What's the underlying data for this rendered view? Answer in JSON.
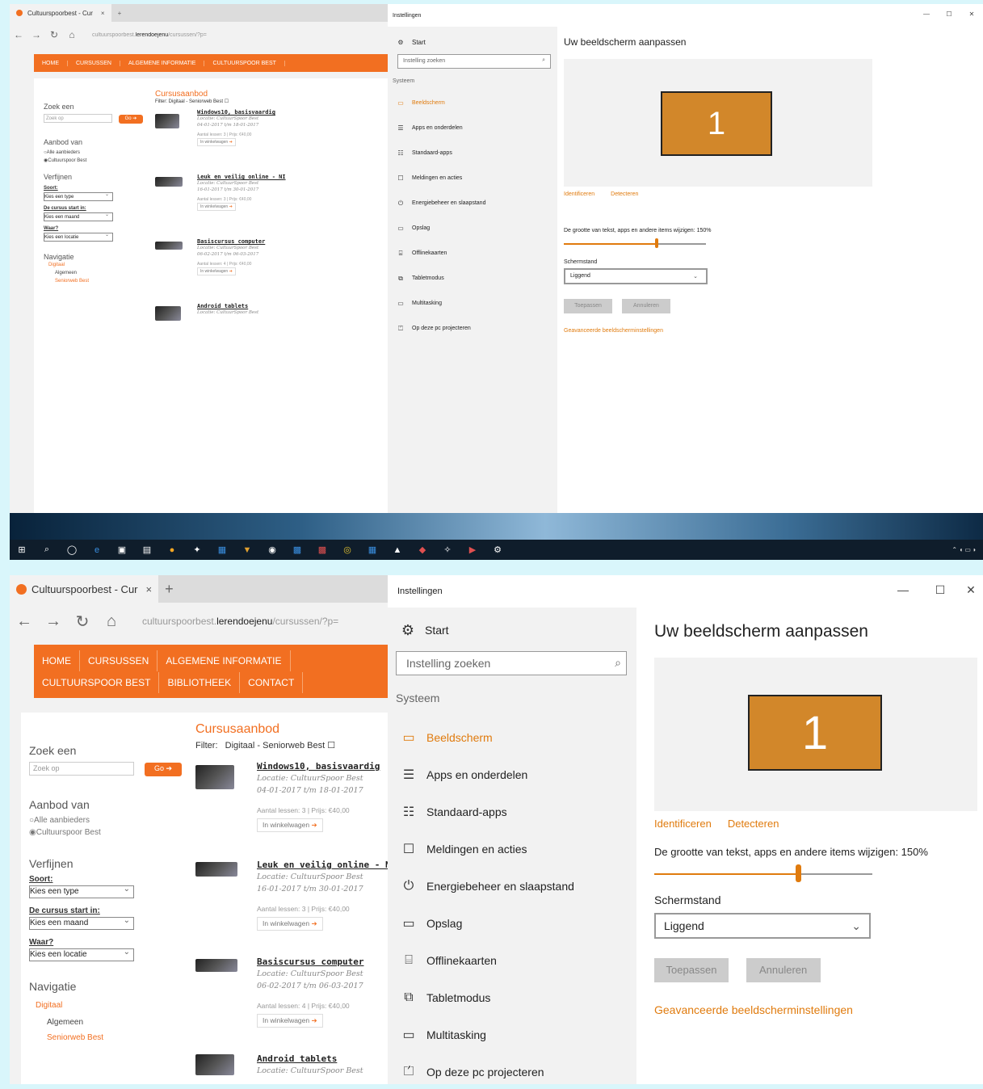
{
  "browser": {
    "tab_title": "Cultuurspoorbest - Cur",
    "tab_close": "×",
    "new_tab": "+",
    "url_prefix": "cultuurspoorbest.",
    "url_domain": "lerendoejenu",
    "url_suffix": "/cursussen/?p=",
    "site_nav": [
      "HOME",
      "CURSUSSEN",
      "ALGEMENE INFORMATIE",
      "CULTUURSPOOR BEST",
      "BIBLIOTHEEK",
      "CONTACT"
    ],
    "sidebar": {
      "search_heading": "Zoek een",
      "search_placeholder": "Zoek op",
      "go_button": "Go ➔",
      "offer_heading": "Aanbod van",
      "offer_options": [
        "Alle aanbieders",
        "Cultuurspoor Best"
      ],
      "refine_heading": "Verfijnen",
      "sort_label": "Soort:",
      "sort_value": "Kies een type",
      "start_label": "De cursus start in:",
      "start_value": "Kies een maand",
      "where_label": "Waar?",
      "where_value": "Kies een locatie",
      "nav_heading": "Navigatie",
      "nav_items": [
        "Digitaal",
        "Algemeen",
        "Seniorweb Best"
      ]
    },
    "results": {
      "title": "Cursusaanbod",
      "filter_label": "Filter:",
      "filter_value": "Digitaal - Seniorweb Best",
      "courses": [
        {
          "name": "Windows10, basisvaardig",
          "location": "Locatie: CultuurSpoor Best",
          "dates": "04-01-2017 t/m 18-01-2017",
          "info": "Aantal lessen: 3 | Prijs: €40,00",
          "cart": "In winkelwagen"
        },
        {
          "name": "Leuk en veilig online - NI",
          "location": "Locatie: CultuurSpoor Best",
          "dates": "16-01-2017 t/m 30-01-2017",
          "info": "Aantal lessen: 3 | Prijs: €40,00",
          "cart": "In winkelwagen"
        },
        {
          "name": "Basiscursus computer",
          "location": "Locatie: CultuurSpoor Best",
          "dates": "06-02-2017 t/m 06-03-2017",
          "info": "Aantal lessen: 4 | Prijs: €40,00",
          "cart": "In winkelwagen"
        },
        {
          "name": "Android tablets",
          "location": "Locatie: CultuurSpoor Best",
          "dates": "",
          "info": "",
          "cart": ""
        }
      ]
    }
  },
  "settings": {
    "window_title": "Instellingen",
    "window_controls": [
      "—",
      "☐",
      "✕"
    ],
    "nav": {
      "home": "Start",
      "search_placeholder": "Instelling zoeken",
      "section": "Systeem",
      "items": [
        "Beeldscherm",
        "Apps en onderdelen",
        "Standaard-apps",
        "Meldingen en acties",
        "Energiebeheer en slaapstand",
        "Opslag",
        "Offlinekaarten",
        "Tabletmodus",
        "Multitasking",
        "Op deze pc projecteren"
      ]
    },
    "content": {
      "title": "Uw beeldscherm aanpassen",
      "monitor_number": "1",
      "identify": "Identificeren",
      "detect": "Detecteren",
      "scale_label": "De grootte van tekst, apps en andere items wijzigen: 150%",
      "scale_fraction": 0.66,
      "orientation_label": "Schermstand",
      "orientation_value": "Liggend",
      "apply": "Toepassen",
      "cancel": "Annuleren",
      "advanced": "Geavanceerde beeldscherminstellingen"
    }
  },
  "colors": {
    "accent": "#e07b0e",
    "brand_orange": "#f26f21",
    "monitor": "#d2872a",
    "background": "#d9f6fb"
  },
  "icons": [
    "gear-icon",
    "display-icon",
    "apps-list-icon",
    "default-apps-icon",
    "notification-icon",
    "power-icon",
    "storage-icon",
    "map-icon",
    "tablet-icon",
    "multitask-icon",
    "project-icon",
    "search-icon",
    "back-icon",
    "forward-icon",
    "refresh-icon",
    "home-icon"
  ]
}
